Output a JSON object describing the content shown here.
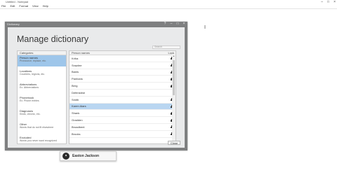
{
  "host": {
    "title": "Untitled - Notepad",
    "menu": [
      "File",
      "Edit",
      "Format",
      "View",
      "Help"
    ],
    "win_controls": [
      "–",
      "□",
      "×"
    ]
  },
  "dialog": {
    "window_title": "Dictionary",
    "controls": [
      "?",
      "–",
      "□",
      "×"
    ],
    "heading": "Manage dictionary",
    "search_placeholder": "Search",
    "categories_header": "Categories",
    "categories": [
      {
        "name": "Person names",
        "desc": "Pronounce, replace, etc."
      },
      {
        "name": "Locations",
        "desc": "Countries, regions, etc."
      },
      {
        "name": "Abbreviations",
        "desc": "Ex. Abbreviations"
      },
      {
        "name": "Phonebook",
        "desc": "Ex. Phone entries"
      },
      {
        "name": "Diagnoses",
        "desc": "Kinds, chronic, etc."
      },
      {
        "name": "Other",
        "desc": "Words that do not fit elsewhere"
      },
      {
        "name": "Excluded",
        "desc": "Words you never want recognized"
      }
    ],
    "names_header": "Person names",
    "names_header_right": "Lock",
    "names": [
      {
        "text": "Kriha",
        "locked": true
      },
      {
        "text": "Snazlee",
        "locked": true
      },
      {
        "text": "Banis",
        "locked": true
      },
      {
        "text": "Panhans",
        "locked": true
      },
      {
        "text": "Berg",
        "locked": true
      },
      {
        "text": "Defenstine",
        "locked": false
      },
      {
        "text": "Smith",
        "locked": true
      },
      {
        "text": "Karen Aiars",
        "locked": true
      },
      {
        "text": "Shank",
        "locked": true
      },
      {
        "text": "Gradden",
        "locked": true
      },
      {
        "text": "Broadbent",
        "locked": true
      },
      {
        "text": "Brooks",
        "locked": true
      }
    ],
    "selected_name_index": 7,
    "close_label": "Close"
  },
  "narrator": {
    "name": "Easton Jackson"
  }
}
